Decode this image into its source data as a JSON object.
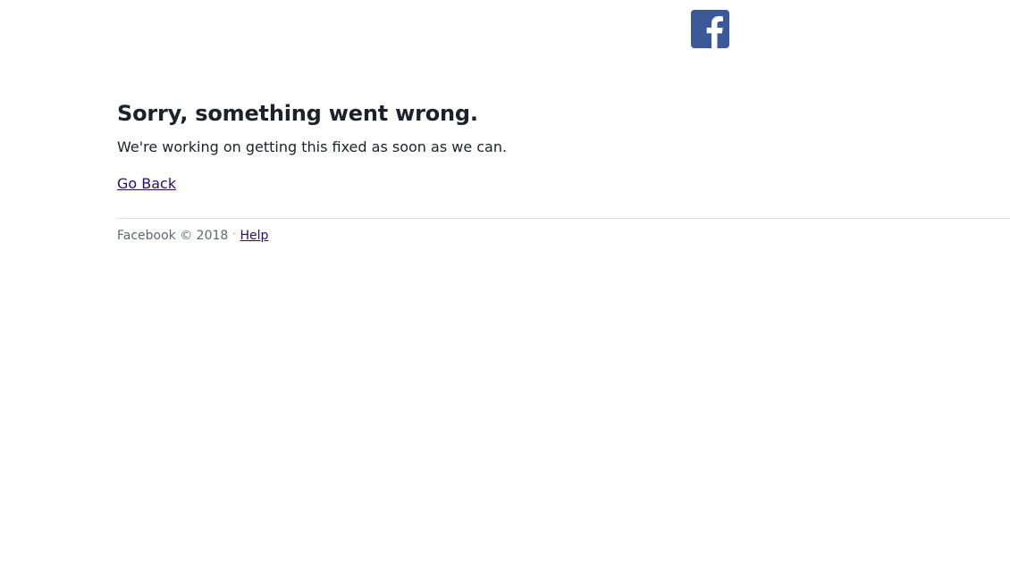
{
  "brand": {
    "logo_icon": "facebook-logo-icon",
    "logo_color": "#3b5998"
  },
  "error": {
    "title": "Sorry, something went wrong.",
    "message": "We're working on getting this fixed as soon as we can.",
    "back_link": "Go Back"
  },
  "footer": {
    "copyright": "Facebook © 2018",
    "separator": "·",
    "help_link": "Help"
  }
}
